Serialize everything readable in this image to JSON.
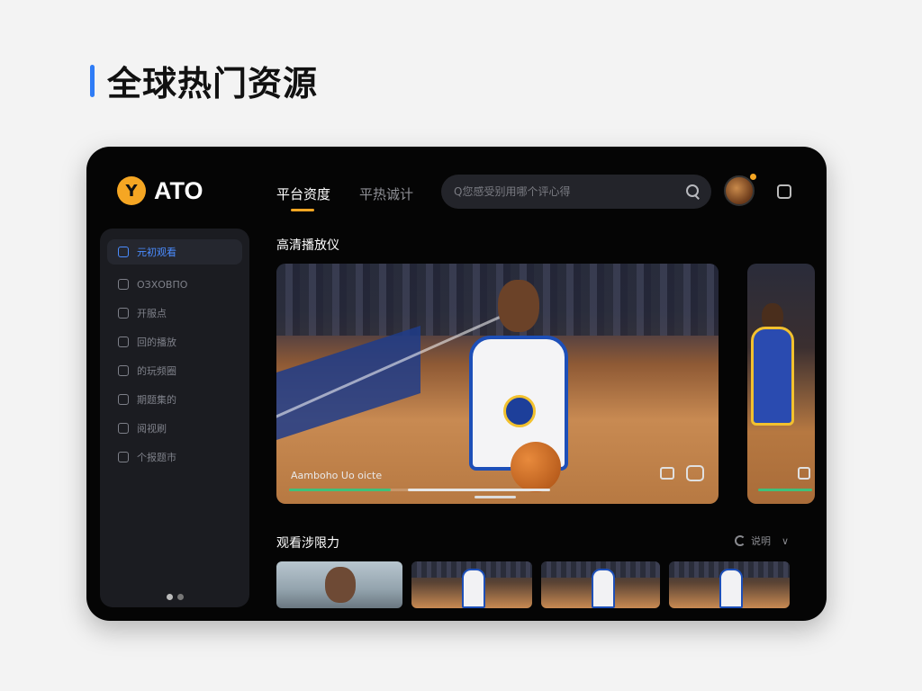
{
  "page": {
    "heading": "全球热门资源",
    "accent_color": "#2f7cf6"
  },
  "app": {
    "logo_text": "ATO",
    "logo_mark": "Y",
    "brand_color": "#f5a623"
  },
  "sidebar": {
    "items": [
      {
        "label": "元初观看",
        "icon": "doc-icon",
        "active": true
      },
      {
        "label": "ОЗХОВПО",
        "icon": "tv-icon"
      },
      {
        "label": "开服点",
        "icon": "home-icon"
      },
      {
        "label": "回的播放",
        "icon": "screen-icon"
      },
      {
        "label": "的玩频圈",
        "icon": "chart-icon"
      },
      {
        "label": "期题集的",
        "icon": "shield-icon"
      },
      {
        "label": "阅视刷",
        "icon": "chat-icon"
      },
      {
        "label": "个报题市",
        "icon": "tag-icon"
      }
    ],
    "pager_dots": 2,
    "pager_active": 0
  },
  "header": {
    "tabs": [
      {
        "label": "平台资度",
        "active": true
      },
      {
        "label": "平热诚计",
        "active": false
      }
    ],
    "search_placeholder": "Q您感受别用哪个评心得"
  },
  "main": {
    "section1_title": "高清播放仪",
    "hero": {
      "caption": "Aamboho Uo oicte",
      "progress": 0.41
    },
    "section2_title": "观看涉限力",
    "section2_action": "说明"
  }
}
